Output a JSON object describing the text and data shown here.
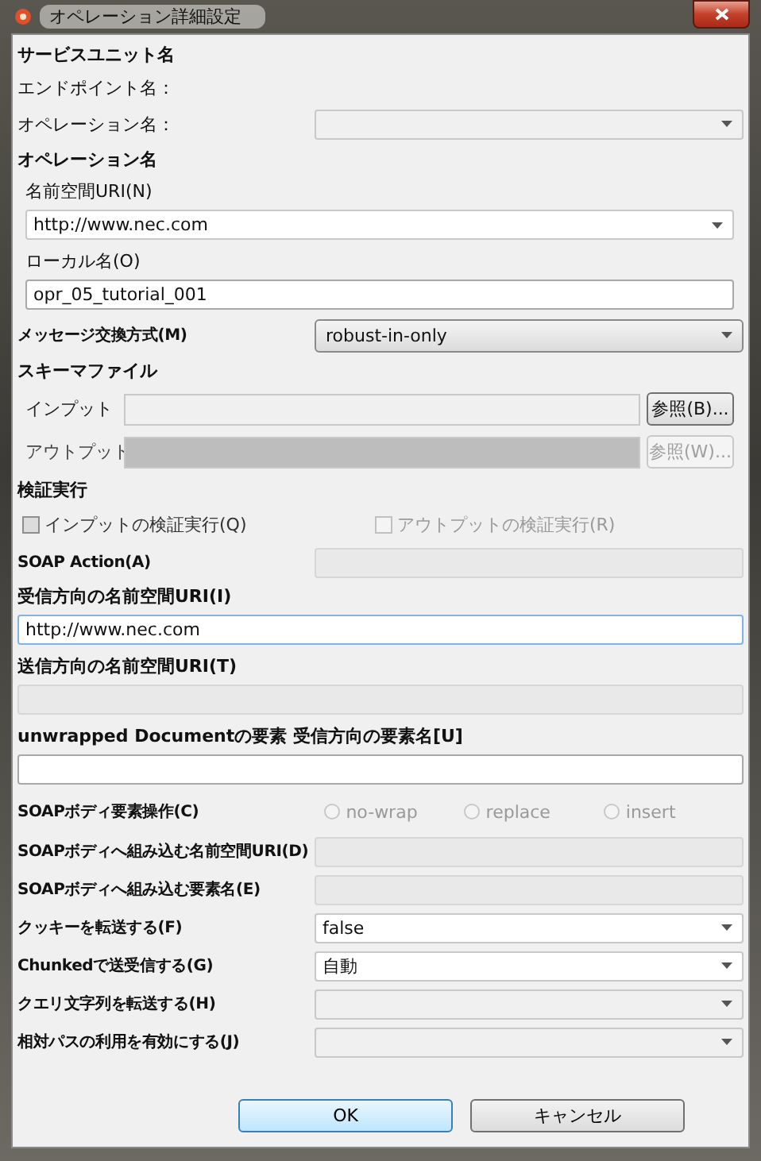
{
  "window": {
    "title": "オペレーション詳細設定"
  },
  "rows": [
    {
      "kind": "heading",
      "text": "サービスユニット名"
    },
    {
      "kind": "text",
      "text": "エンドポイント名："
    },
    {
      "kind": "pair",
      "label": "オペレーション名：",
      "bold": false,
      "control": {
        "kind": "combo",
        "disabled": true
      }
    },
    {
      "kind": "heading",
      "text": "オペレーション名"
    },
    {
      "kind": "stacked",
      "label": "名前空間URI(N)",
      "bold": false,
      "indent": true,
      "control": {
        "kind": "combo",
        "disabled": false,
        "value": "http://www.nec.com"
      }
    },
    {
      "kind": "stacked",
      "label": "ローカル名(O)",
      "bold": false,
      "indent": true,
      "control": {
        "kind": "input",
        "disabled": false,
        "value": "opr_05_tutorial_001"
      }
    },
    {
      "kind": "pair",
      "label": "メッセージ交換方式(M)",
      "bold": true,
      "control": {
        "kind": "dropdown",
        "value": "robust-in-only"
      }
    },
    {
      "kind": "heading",
      "text": "スキーマファイル"
    },
    {
      "kind": "file",
      "label": "インプット",
      "disabled": false,
      "button": "参照(B)..."
    },
    {
      "kind": "file",
      "label": "アウトプット",
      "disabled": true,
      "button": "参照(W)..."
    },
    {
      "kind": "heading",
      "text": "検証実行"
    },
    {
      "kind": "checks",
      "items": [
        {
          "label": "インプットの検証実行(Q)",
          "checked": false,
          "disabled": false
        },
        {
          "label": "アウトプットの検証実行(R)",
          "checked": false,
          "disabled": true
        }
      ]
    },
    {
      "kind": "pair",
      "label": "SOAP Action(A)",
      "bold": true,
      "control": {
        "kind": "input",
        "disabled": true
      }
    },
    {
      "kind": "stacked",
      "label": "受信方向の名前空間URI(I)",
      "bold": true,
      "indent": false,
      "control": {
        "kind": "input",
        "disabled": false,
        "focused": true,
        "value": "http://www.nec.com"
      }
    },
    {
      "kind": "stacked",
      "label": "送信方向の名前空間URI(T)",
      "bold": true,
      "indent": false,
      "control": {
        "kind": "input",
        "disabled": true
      }
    },
    {
      "kind": "stacked",
      "label": "unwrapped Documentの要素 受信方向の要素名[U]",
      "bold": true,
      "indent": false,
      "control": {
        "kind": "input",
        "disabled": false
      }
    },
    {
      "kind": "radios",
      "label": "SOAPボディ要素操作(C)",
      "items": [
        {
          "label": "no-wrap",
          "selected": false,
          "disabled": true
        },
        {
          "label": "replace",
          "selected": false,
          "disabled": true
        },
        {
          "label": "insert",
          "selected": false,
          "disabled": true
        }
      ]
    },
    {
      "kind": "pair",
      "label": "SOAPボディへ組み込む名前空間URI(D)",
      "bold": true,
      "control": {
        "kind": "input",
        "disabled": true
      }
    },
    {
      "kind": "pair",
      "label": "SOAPボディへ組み込む要素名(E)",
      "bold": true,
      "control": {
        "kind": "input",
        "disabled": true
      }
    },
    {
      "kind": "pair",
      "label": "クッキーを転送する(F)",
      "bold": true,
      "control": {
        "kind": "combo",
        "disabled": false,
        "value": "false"
      }
    },
    {
      "kind": "pair",
      "label": "Chunkedで送受信する(G)",
      "bold": true,
      "control": {
        "kind": "combo",
        "disabled": false,
        "value": "自動"
      }
    },
    {
      "kind": "pair",
      "label": "クエリ文字列を転送する(H)",
      "bold": true,
      "control": {
        "kind": "combo",
        "disabled": true
      }
    },
    {
      "kind": "pair",
      "label": "相対パスの利用を有効にする(J)",
      "bold": true,
      "control": {
        "kind": "combo",
        "disabled": true
      }
    }
  ],
  "buttons": [
    {
      "label": "OK",
      "default": true
    },
    {
      "label": "キャンセル",
      "default": false
    }
  ]
}
